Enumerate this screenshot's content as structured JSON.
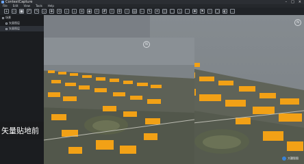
{
  "window": {
    "title": "ContextCapture",
    "controls": [
      "–",
      "□",
      "×"
    ]
  },
  "menu": {
    "items": [
      "File",
      "Edit",
      "View",
      "Tools",
      "Help"
    ]
  },
  "toolbar": {
    "icons": [
      "new-icon",
      "open-icon",
      "save-icon",
      "undo-icon",
      "redo-icon",
      "select-icon",
      "move-icon",
      "rotate-icon",
      "zoom-icon",
      "measure-icon",
      "layer-icon",
      "camera-icon",
      "light-icon",
      "grid-icon",
      "export-icon",
      "settings-icon"
    ]
  },
  "sidebar": {
    "items": [
      {
        "label": "场景"
      },
      {
        "label": "矢量图层"
      },
      {
        "label": "矢量图层"
      }
    ]
  },
  "viewport": {
    "overlay_label": "矢量贴地前"
  },
  "watermark": {
    "text": "大疆智图"
  },
  "colors": {
    "building_highlight": "#f2a116",
    "water": "#7d8489",
    "ground": "#5b5f55"
  }
}
